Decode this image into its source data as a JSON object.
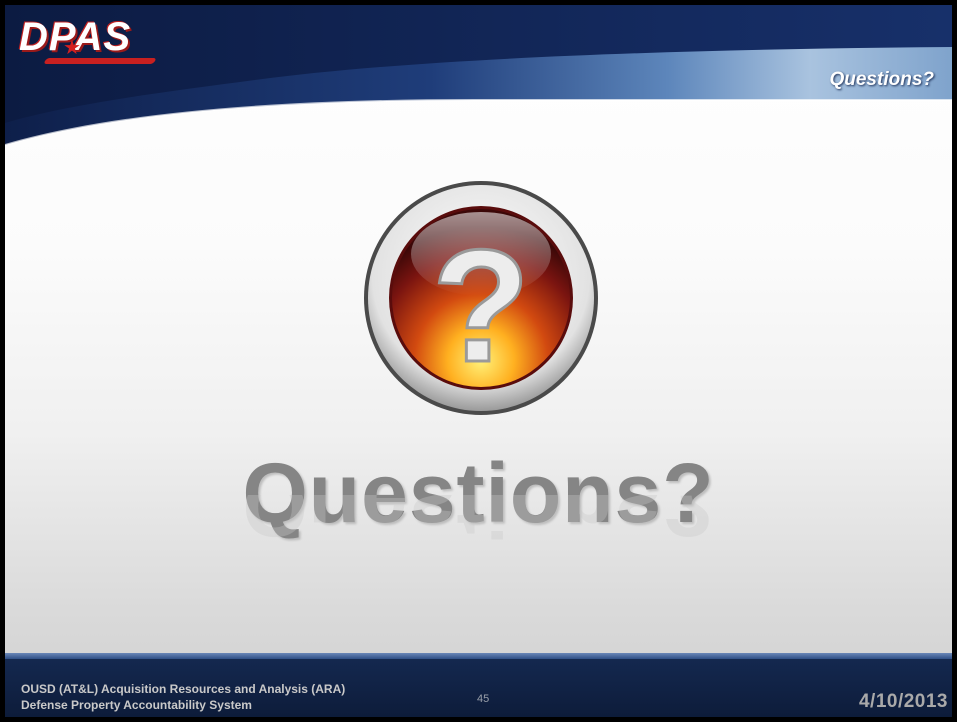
{
  "header": {
    "logo_text": "DPAS",
    "title": "Questions?"
  },
  "main": {
    "icon_name": "question-mark-icon",
    "heading": "Questions?"
  },
  "footer": {
    "org_line1": "OUSD (AT&L) Acquisition Resources and Analysis (ARA)",
    "org_line2": "Defense Property Accountability System",
    "page_number": "45",
    "date": "4/10/2013"
  },
  "colors": {
    "header_navy": "#1a2f63",
    "footer_navy": "#14284f",
    "logo_red": "#c82020",
    "heading_gray": "#858585"
  }
}
